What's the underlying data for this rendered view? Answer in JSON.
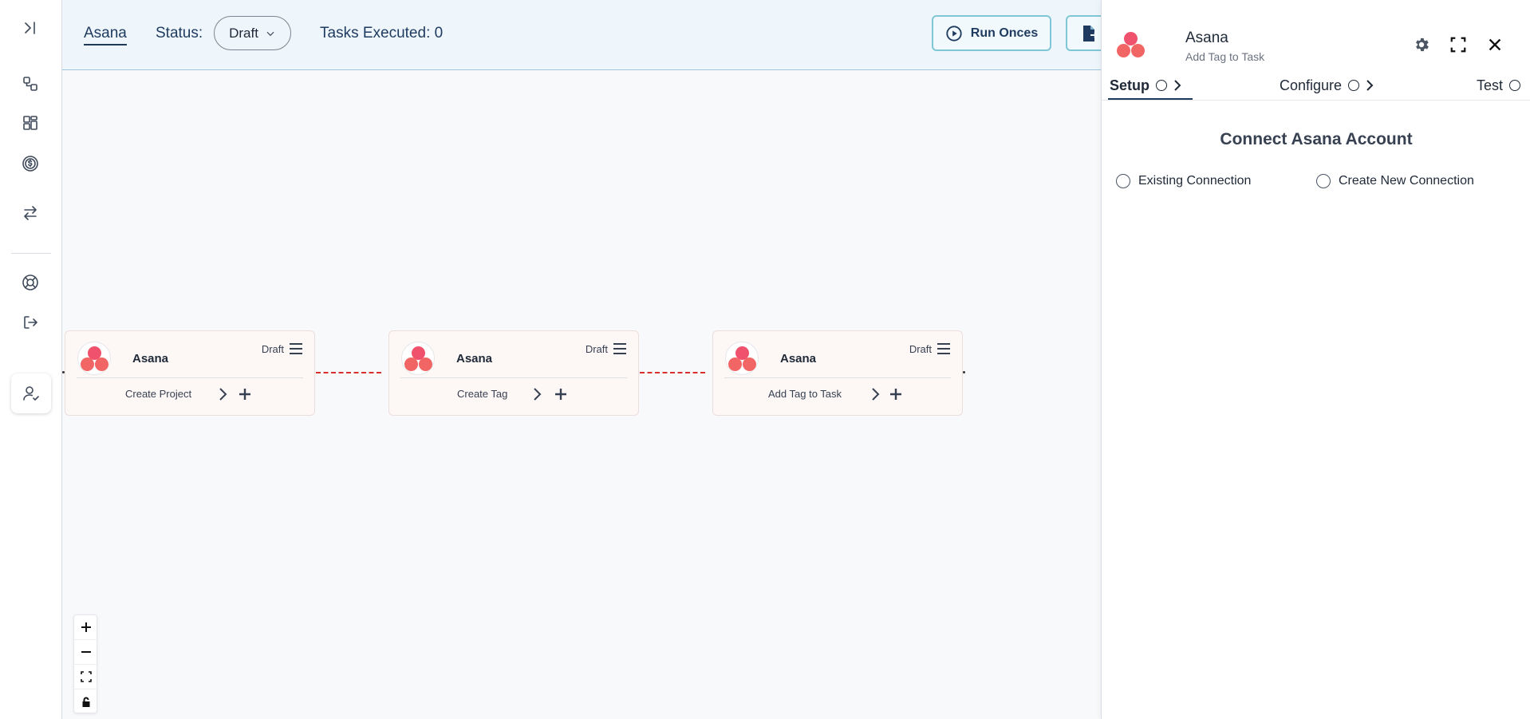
{
  "header": {
    "title": "Asana",
    "status_label": "Status:",
    "status_value": "Draft",
    "tasks_executed": "Tasks Executed: 0",
    "run_button": "Run Onces"
  },
  "nodes": [
    {
      "title": "Asana",
      "status": "Draft",
      "action": "Create Project"
    },
    {
      "title": "Asana",
      "status": "Draft",
      "action": "Create Tag"
    },
    {
      "title": "Asana",
      "status": "Draft",
      "action": "Add Tag to Task"
    }
  ],
  "panel": {
    "title": "Asana",
    "subtitle": "Add Tag to Task",
    "tabs": [
      {
        "label": "Setup"
      },
      {
        "label": "Configure"
      },
      {
        "label": "Test"
      }
    ],
    "heading": "Connect Asana Account",
    "options": [
      {
        "label": "Existing Connection"
      },
      {
        "label": "Create New Connection"
      }
    ]
  },
  "icons": {
    "rail": [
      "collapse-sidebar-icon",
      "workflow-icon",
      "dashboard-icon",
      "billing-icon",
      "transfer-icon",
      "support-icon",
      "logout-icon",
      "user-check-icon"
    ],
    "panel": [
      "settings-icon",
      "fullscreen-icon",
      "close-icon"
    ],
    "zoom": [
      "zoom-in-icon",
      "zoom-out-icon",
      "fit-view-icon",
      "lock-icon"
    ]
  },
  "colors": {
    "brand": "#1e3a5f",
    "accent_border": "#7fc6d6",
    "connector": "#d72e2e",
    "asana_red": "#f0516c",
    "header_bg": "#eef6fc"
  }
}
